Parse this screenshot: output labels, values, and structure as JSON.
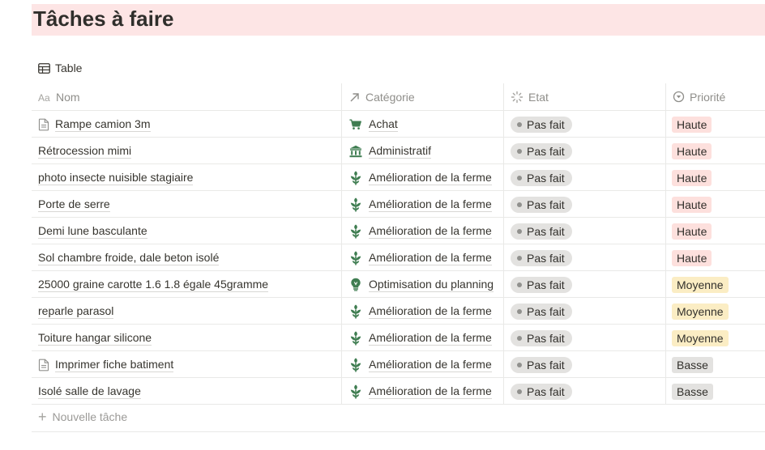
{
  "page": {
    "title": "Tâches à faire"
  },
  "view": {
    "label": "Table",
    "icon": "table-icon"
  },
  "columns": [
    {
      "label": "Nom",
      "icon": "text-property-icon"
    },
    {
      "label": "Catégorie",
      "icon": "relation-arrow-icon"
    },
    {
      "label": "Etat",
      "icon": "status-spinner-icon"
    },
    {
      "label": "Priorité",
      "icon": "select-circle-icon"
    }
  ],
  "colors": {
    "title_bg": "#fde5e5",
    "priority_high": "#fde0dd",
    "priority_medium": "#fbedc4",
    "priority_low": "#e3e2e0",
    "status_bg": "#e3e2e0",
    "category_icon": "#3f7d51"
  },
  "rows": [
    {
      "name": "Rampe camion 3m",
      "doc": true,
      "category": "Achat",
      "category_icon": "shopping-cart-icon",
      "status": "Pas fait",
      "priority": "Haute",
      "priority_level": "high"
    },
    {
      "name": "Rétrocession mimi",
      "doc": false,
      "category": "Administratif",
      "category_icon": "bank-icon",
      "status": "Pas fait",
      "priority": "Haute",
      "priority_level": "high"
    },
    {
      "name": "photo insecte nuisible stagiaire",
      "doc": false,
      "category": "Amélioration de la ferme",
      "category_icon": "sprout-icon",
      "status": "Pas fait",
      "priority": "Haute",
      "priority_level": "high"
    },
    {
      "name": "Porte de serre",
      "doc": false,
      "category": "Amélioration de la ferme",
      "category_icon": "sprout-icon",
      "status": "Pas fait",
      "priority": "Haute",
      "priority_level": "high"
    },
    {
      "name": "Demi lune basculante",
      "doc": false,
      "category": "Amélioration de la ferme",
      "category_icon": "sprout-icon",
      "status": "Pas fait",
      "priority": "Haute",
      "priority_level": "high"
    },
    {
      "name": "Sol chambre froide, dale beton isolé",
      "doc": false,
      "category": "Amélioration de la ferme",
      "category_icon": "sprout-icon",
      "status": "Pas fait",
      "priority": "Haute",
      "priority_level": "high"
    },
    {
      "name": "25000 graine carotte 1.6 1.8 égale 45gramme",
      "doc": false,
      "category": "Optimisation du planning",
      "category_icon": "lightbulb-icon",
      "status": "Pas fait",
      "priority": "Moyenne",
      "priority_level": "medium"
    },
    {
      "name": "reparle parasol",
      "doc": false,
      "category": "Amélioration de la ferme",
      "category_icon": "sprout-icon",
      "status": "Pas fait",
      "priority": "Moyenne",
      "priority_level": "medium"
    },
    {
      "name": "Toiture hangar silicone",
      "doc": false,
      "category": "Amélioration de la ferme",
      "category_icon": "sprout-icon",
      "status": "Pas fait",
      "priority": "Moyenne",
      "priority_level": "medium"
    },
    {
      "name": "Imprimer fiche batiment",
      "doc": true,
      "category": "Amélioration de la ferme",
      "category_icon": "sprout-icon",
      "status": "Pas fait",
      "priority": "Basse",
      "priority_level": "low"
    },
    {
      "name": "Isolé salle de lavage",
      "doc": false,
      "category": "Amélioration de la ferme",
      "category_icon": "sprout-icon",
      "status": "Pas fait",
      "priority": "Basse",
      "priority_level": "low"
    }
  ],
  "new_task": {
    "label": "Nouvelle tâche"
  }
}
